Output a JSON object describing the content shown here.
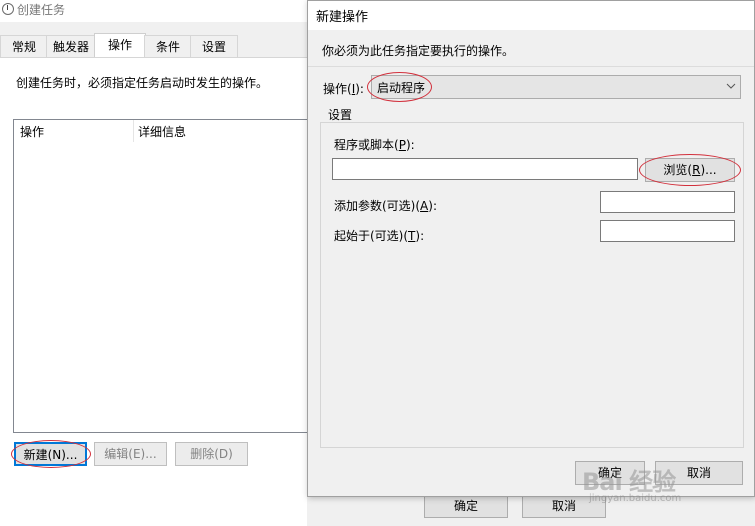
{
  "background_window": {
    "title": "创建任务",
    "tabs": [
      "常规",
      "触发器",
      "操作",
      "条件",
      "设置"
    ],
    "active_tab": "操作",
    "description": "创建任务时，必须指定任务启动时发生的操作。",
    "list_columns": [
      "操作",
      "详细信息"
    ],
    "buttons": {
      "new": "新建(N)...",
      "edit": "编辑(E)...",
      "delete": "删除(D)"
    },
    "footer": {
      "ok": "确定",
      "cancel": "取消"
    }
  },
  "dialog": {
    "title": "新建操作",
    "instruction": "你必须为此任务指定要执行的操作。",
    "action_label": "操作(I):",
    "action_value": "启动程序",
    "settings_label": "设置",
    "program_label": "程序或脚本(P):",
    "program_value": "",
    "browse_button": "浏览(R)...",
    "args_label": "添加参数(可选)(A):",
    "args_value": "",
    "start_label": "起始于(可选)(T):",
    "start_value": "",
    "ok_button_partial": "确定",
    "cancel_button_partial": "取消"
  },
  "watermark": {
    "logo_text": "Bai 经验",
    "url": "jingyan.baidu.com"
  },
  "colors": {
    "annotation_red": "#d2303c",
    "focus_blue": "#0078d7"
  },
  "icons": [
    "task-scheduler-icon",
    "chevron-down-icon"
  ]
}
